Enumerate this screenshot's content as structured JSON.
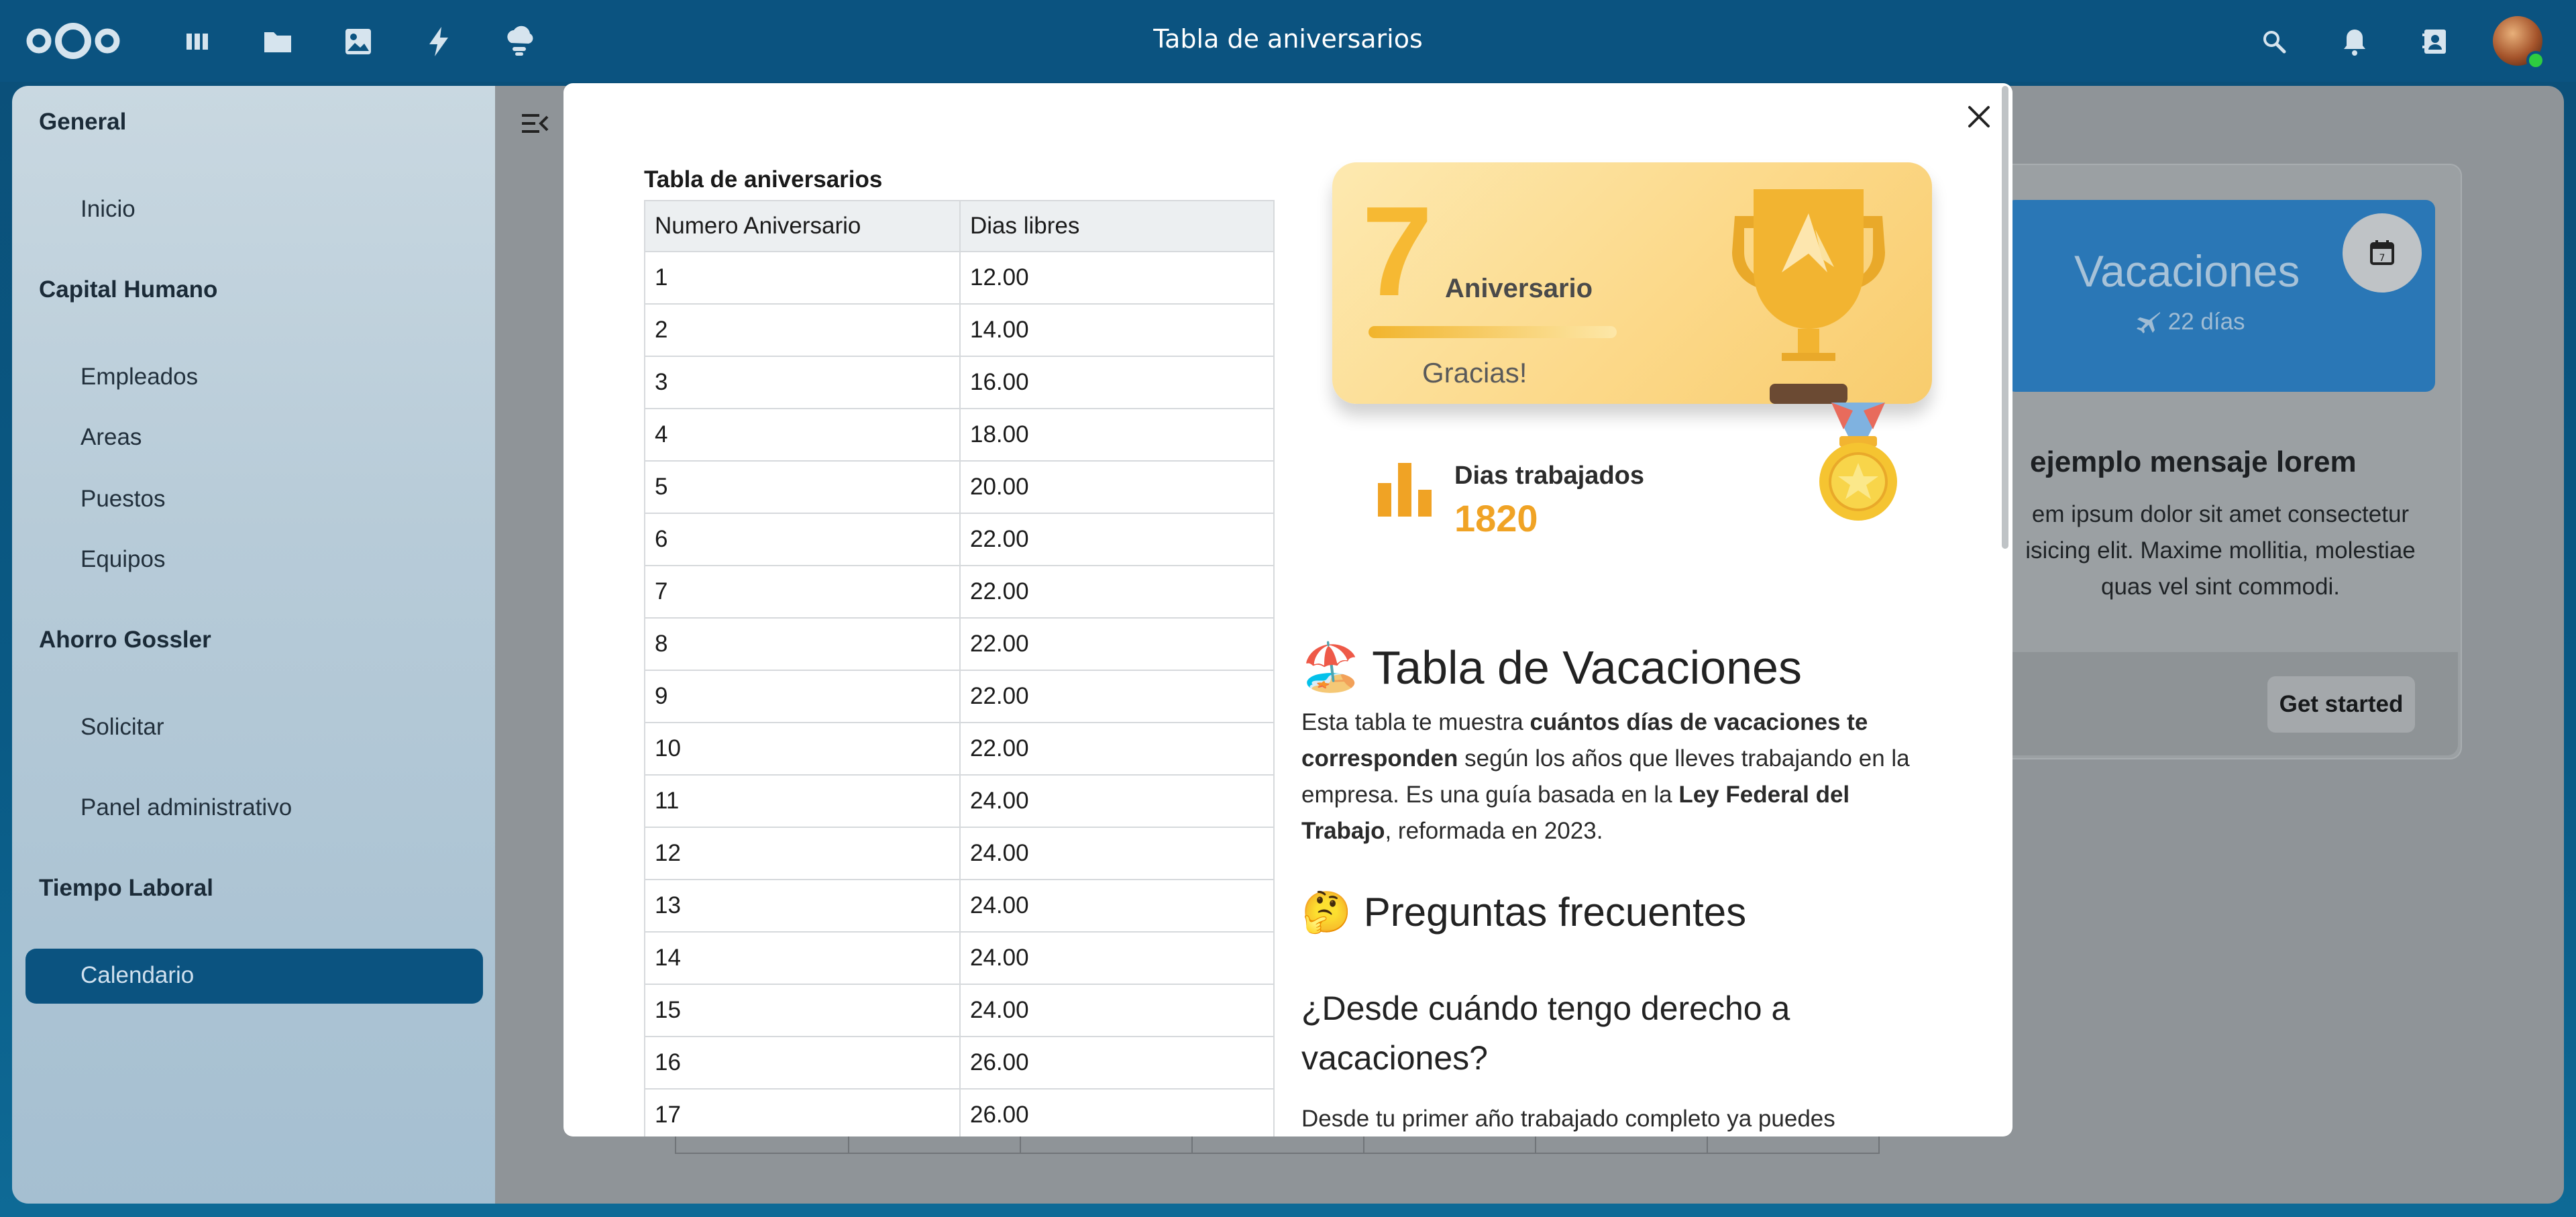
{
  "header": {
    "title": "Tabla de aniversarios",
    "icons": [
      "nextcloud-logo",
      "dashboard-icon",
      "files-icon",
      "photos-icon",
      "activity-icon",
      "weather-icon",
      "search-icon",
      "bell-icon",
      "contacts-icon"
    ]
  },
  "sidebar": {
    "sections": [
      {
        "label": "General",
        "items": [
          "Inicio"
        ]
      },
      {
        "label": "Capital Humano",
        "items": [
          "Empleados",
          "Areas",
          "Puestos",
          "Equipos"
        ]
      },
      {
        "label": "Ahorro Gossler",
        "items": [
          "Solicitar",
          "Panel administrativo"
        ]
      },
      {
        "label": "Tiempo Laboral",
        "items": [
          "Calendario"
        ]
      }
    ],
    "active": "Calendario"
  },
  "background_card": {
    "title": "Vacaciones",
    "days": "22 días",
    "message_title": "ejemplo mensaje lorem",
    "message_body": "em ipsum dolor sit amet consectetur isicing elit. Maxime mollitia, molestiae quas vel sint commodi.",
    "button": "Get started"
  },
  "modal": {
    "table_title": "Tabla de aniversarios",
    "columns": [
      "Numero Aniversario",
      "Dias libres"
    ],
    "rows": [
      [
        "1",
        "12.00"
      ],
      [
        "2",
        "14.00"
      ],
      [
        "3",
        "16.00"
      ],
      [
        "4",
        "18.00"
      ],
      [
        "5",
        "20.00"
      ],
      [
        "6",
        "22.00"
      ],
      [
        "7",
        "22.00"
      ],
      [
        "8",
        "22.00"
      ],
      [
        "9",
        "22.00"
      ],
      [
        "10",
        "22.00"
      ],
      [
        "11",
        "24.00"
      ],
      [
        "12",
        "24.00"
      ],
      [
        "13",
        "24.00"
      ],
      [
        "14",
        "24.00"
      ],
      [
        "15",
        "24.00"
      ],
      [
        "16",
        "26.00"
      ],
      [
        "17",
        "26.00"
      ]
    ],
    "anniversary": {
      "number": "7",
      "label": "Aniversario",
      "thanks": "Gracias!",
      "stats_label": "Dias trabajados",
      "stats_value": "1820"
    },
    "vacation_heading": "Tabla de Vacaciones",
    "vacation_heading_emoji": "🏖️",
    "vacation_text": {
      "t1": "Esta tabla te muestra ",
      "b1": "cuántos días de vacaciones te corresponden",
      "t2": " según los años que lleves trabajando en la empresa. Es una guía basada en la ",
      "b2": "Ley Federal del Trabajo",
      "t3": ", reformada en 2023."
    },
    "faq_heading": "Preguntas frecuentes",
    "faq_heading_emoji": "🤔",
    "q1_heading": "¿Desde cuándo tengo derecho a vacaciones?",
    "q1_text": "Desde tu primer año trabajado completo ya puedes"
  },
  "colors": {
    "header": "#0b5380",
    "accent_gold": "#f6b933",
    "stat_orange": "#f0a325",
    "card_blue": "#2a77b6"
  }
}
